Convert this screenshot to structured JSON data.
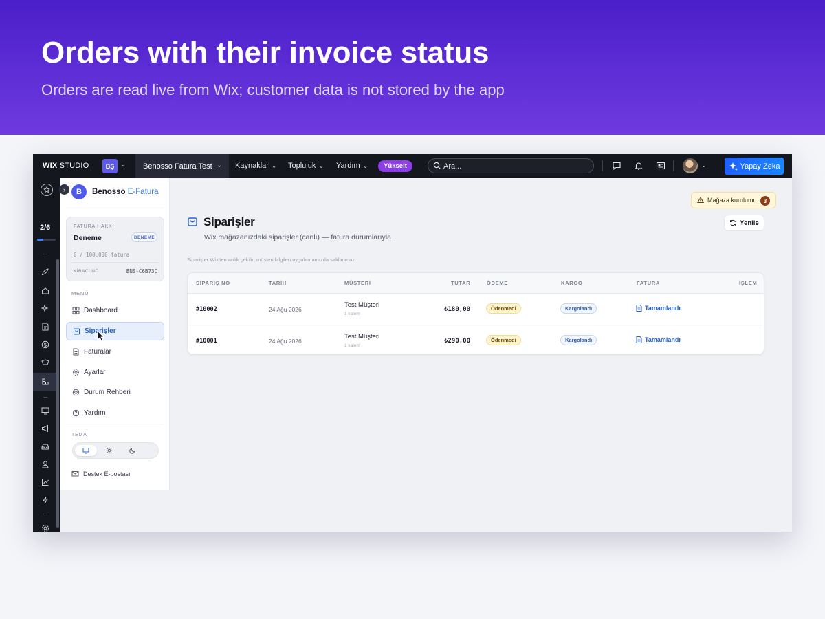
{
  "hero": {
    "title": "Orders with their invoice status",
    "subtitle": "Orders are read live from Wix; customer data is not stored by the app"
  },
  "topbar": {
    "logo_bold": "WIX",
    "logo_light": "STUDIO",
    "workspace_badge": "BŞ",
    "site_name": "Benosso Fatura Test",
    "nav": [
      "Kaynaklar",
      "Topluluk",
      "Yardım"
    ],
    "upgrade_label": "Yükselt",
    "search_placeholder": "Ara...",
    "ai_button": "Yapay Zeka"
  },
  "rail": {
    "progress": "2/6",
    "progress_fraction": 0.33
  },
  "sidebar": {
    "app_logo": "B",
    "app_name": "Benosso",
    "app_name_accent": "E-Fatura",
    "quota_card": {
      "label": "FATURA HAKKI",
      "plan": "Deneme",
      "badge": "DENEME",
      "usage": "0 / 100.000 fatura",
      "tenant_label": "KİRACI NO",
      "tenant_value": "BNS-C6B73C"
    },
    "menu_label": "MENÜ",
    "menu": [
      {
        "label": "Dashboard",
        "icon": "grid-icon"
      },
      {
        "label": "Siparişler",
        "icon": "bag-icon",
        "active": true
      },
      {
        "label": "Faturalar",
        "icon": "document-icon"
      },
      {
        "label": "Ayarlar",
        "icon": "gear-icon"
      },
      {
        "label": "Durum Rehberi",
        "icon": "lifebuoy-icon"
      },
      {
        "label": "Yardım",
        "icon": "help-icon"
      }
    ],
    "theme_label": "TEMA",
    "theme_options": [
      "monitor-icon",
      "sun-icon",
      "moon-icon"
    ],
    "support": "Destek E-postası"
  },
  "main": {
    "store_setup": "Mağaza kurulumu",
    "store_setup_count": "3",
    "refresh": "Yenile",
    "title": "Siparişler",
    "subtitle": "Wix mağazanızdaki siparişler (canlı) — fatura durumlarıyla",
    "note": "Siparişler Wix'ten anlık çekilir; müşteri bilgileri uygulamamızda saklanmaz.",
    "columns": [
      "SİPARİŞ NO",
      "TARİH",
      "MÜŞTERİ",
      "TUTAR",
      "ÖDEME",
      "KARGO",
      "FATURA",
      "İŞLEM"
    ],
    "rows": [
      {
        "id": "#10002",
        "date": "24 Ağu 2026",
        "customer": "Test Müşteri",
        "items": "1 kalem",
        "amount": "₺180,00",
        "payment": "Ödenmedi",
        "shipping": "Kargolandı",
        "invoice": "Tamamlandı"
      },
      {
        "id": "#10001",
        "date": "24 Ağu 2026",
        "customer": "Test Müşteri",
        "items": "1 kalem",
        "amount": "₺290,00",
        "payment": "Ödenmedi",
        "shipping": "Kargolandı",
        "invoice": "Tamamlandı"
      }
    ]
  },
  "colors": {
    "hero_top": "#4a1fc9",
    "hero_bottom": "#6f3ae0",
    "accent_blue": "#2563c9",
    "upgrade": "#8b3ee6",
    "topbar": "#15171f"
  }
}
